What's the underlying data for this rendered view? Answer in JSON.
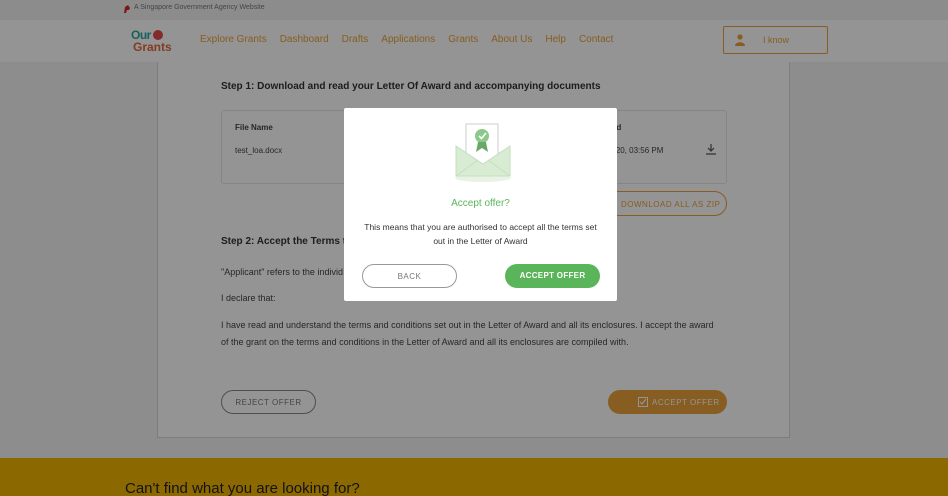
{
  "gov_banner": {
    "text": "A Singapore Government Agency Website"
  },
  "logo": {
    "top": "Our",
    "bottom": "Grants"
  },
  "nav": {
    "links": [
      "Explore Grants",
      "Dashboard",
      "Drafts",
      "Applications",
      "Grants",
      "About Us",
      "Help",
      "Contact"
    ],
    "user_name": "I know"
  },
  "step1": {
    "title": "Step 1: Download and read your Letter Of Award and accompanying documents",
    "col_file_name": "File Name",
    "col_uploaded": "ded",
    "file_name": "test_loa.docx",
    "uploaded": "r 2020, 03:56 PM",
    "zip_label": "DOWNLOAD ALL AS ZIP"
  },
  "step2": {
    "title": "Step 2: Accept the Terms to",
    "applicant_text": "\"Applicant\" refers to the individ",
    "declare_text": "I declare that:",
    "terms_text": "I have read and understand the terms and conditions set out in the Letter of Award and all its enclosures. I accept the award of the grant on the terms and conditions in the Letter of Award and all its enclosures are compiled with."
  },
  "actions": {
    "reject_label": "REJECT OFFER",
    "accept_label": "ACCEPT OFFER"
  },
  "footer": {
    "text": "Can't find what you are looking for?"
  },
  "modal": {
    "title": "Accept offer?",
    "message": "This means that you are authorised to accept all the terms set out in the Letter of Award",
    "back_label": "BACK",
    "accept_label": "ACCEPT OFFER"
  },
  "colors": {
    "accent": "#e8a13a",
    "success": "#5ab55a",
    "footer": "#f0b400"
  },
  "icons": [
    "lion-icon",
    "user-icon",
    "download-icon",
    "checkbox-icon",
    "envelope-award-icon"
  ]
}
